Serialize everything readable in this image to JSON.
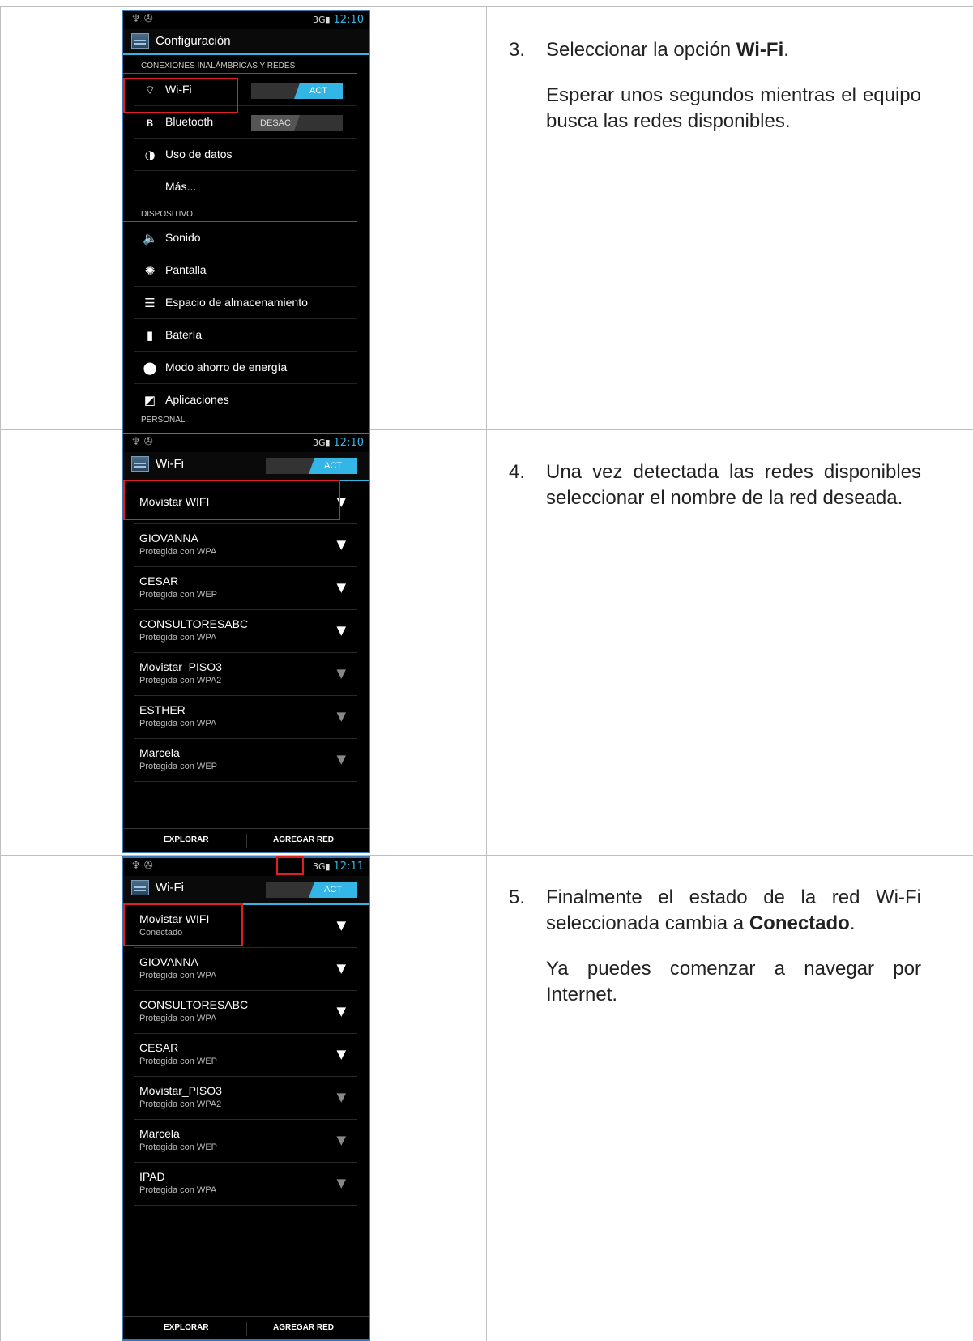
{
  "colors": {
    "accent": "#33b5e5",
    "highlight": "#e02020",
    "border": "#3a78b5"
  },
  "screen1": {
    "status_icons": "♆ ✇",
    "status_bars": "3G▮",
    "time": "12:10",
    "title": "Configuración",
    "section1": "CONEXIONES INALÁMBRICAS Y REDES",
    "items": [
      {
        "icon": "wifi-icon",
        "glyph": "⌔",
        "label": "Wi-Fi",
        "toggle": "ACT"
      },
      {
        "icon": "bluetooth-icon",
        "glyph": "ʙ",
        "label": "Bluetooth",
        "toggle": "DESAC"
      },
      {
        "icon": "data-usage-icon",
        "glyph": "◑",
        "label": "Uso de datos"
      },
      {
        "label": "Más..."
      }
    ],
    "section2": "DISPOSITIVO",
    "items2": [
      {
        "icon": "sound-icon",
        "glyph": "🔈",
        "label": "Sonido"
      },
      {
        "icon": "display-icon",
        "glyph": "✺",
        "label": "Pantalla"
      },
      {
        "icon": "storage-icon",
        "glyph": "☰",
        "label": "Espacio de almacenamiento"
      },
      {
        "icon": "battery-icon",
        "glyph": "▮",
        "label": "Batería"
      },
      {
        "icon": "power-saving-icon",
        "glyph": "⬤",
        "label": "Modo ahorro de energía"
      },
      {
        "icon": "apps-icon",
        "glyph": "◩",
        "label": "Aplicaciones"
      }
    ],
    "section3": "PERSONAL"
  },
  "screen2": {
    "time": "12:10",
    "title": "Wi-Fi",
    "toggle": "ACT",
    "networks": [
      {
        "name": "Movistar WIFI",
        "sub": ""
      },
      {
        "name": "GIOVANNA",
        "sub": "Protegida con WPA"
      },
      {
        "name": "CESAR",
        "sub": "Protegida con WEP"
      },
      {
        "name": "CONSULTORESABC",
        "sub": "Protegida con WPA"
      },
      {
        "name": "Movistar_PISO3",
        "sub": "Protegida con WPA2"
      },
      {
        "name": "ESTHER",
        "sub": "Protegida con WPA"
      },
      {
        "name": "Marcela",
        "sub": "Protegida con WEP"
      }
    ],
    "btn_scan": "EXPLORAR",
    "btn_add": "AGREGAR RED"
  },
  "screen3": {
    "time": "12:11",
    "title": "Wi-Fi",
    "toggle": "ACT",
    "networks": [
      {
        "name": "Movistar WIFI",
        "sub": "Conectado"
      },
      {
        "name": "GIOVANNA",
        "sub": "Protegida con WPA"
      },
      {
        "name": "CONSULTORESABC",
        "sub": "Protegida con WPA"
      },
      {
        "name": "CESAR",
        "sub": "Protegida con WEP"
      },
      {
        "name": "Movistar_PISO3",
        "sub": "Protegida con WPA2"
      },
      {
        "name": "Marcela",
        "sub": "Protegida con WEP"
      },
      {
        "name": "IPAD",
        "sub": "Protegida con WPA"
      }
    ],
    "btn_scan": "EXPLORAR",
    "btn_add": "AGREGAR RED"
  },
  "steps": [
    {
      "num": "3.",
      "a": "Seleccionar la opción ",
      "b": "Wi-Fi",
      "c": ".",
      "p2": "Esperar unos segundos mientras el equipo busca las redes disponibles."
    },
    {
      "num": "4.",
      "p1": "Una vez detectada las redes disponibles seleccionar el nombre de la red deseada."
    },
    {
      "num": "5.",
      "a": "Finalmente el estado de la red Wi-Fi seleccionada cambia a ",
      "b": "Conectado",
      "c": ".",
      "p2": "Ya puedes comenzar a navegar por Internet."
    }
  ]
}
